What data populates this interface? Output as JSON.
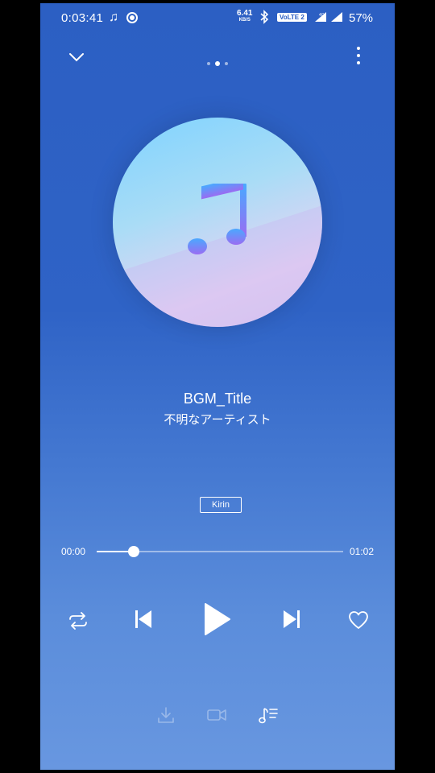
{
  "status_bar": {
    "time": "0:03:41",
    "net_speed": "6.41",
    "net_speed_unit": "KB/S",
    "volte": "VoLTE 2",
    "network": "4G",
    "battery": "57%"
  },
  "pager": {
    "count": 3,
    "active": 1
  },
  "track": {
    "title": "BGM_Title",
    "artist": "不明なアーティスト",
    "badge": "Kirin"
  },
  "playback": {
    "current_time": "00:00",
    "total_time": "01:02",
    "progress": 0.15,
    "state": "paused"
  },
  "colors": {
    "background_top": "#2c5fc3",
    "background_bottom": "#6897e0",
    "foreground": "#ffffff"
  },
  "icons": {
    "collapse": "chevron-down-icon",
    "more": "more-vertical-icon",
    "repeat": "repeat-icon",
    "previous": "skip-previous-icon",
    "play": "play-icon",
    "next": "skip-next-icon",
    "favorite": "heart-icon",
    "download": "download-icon",
    "video": "video-icon",
    "lyrics": "lyrics-icon"
  }
}
